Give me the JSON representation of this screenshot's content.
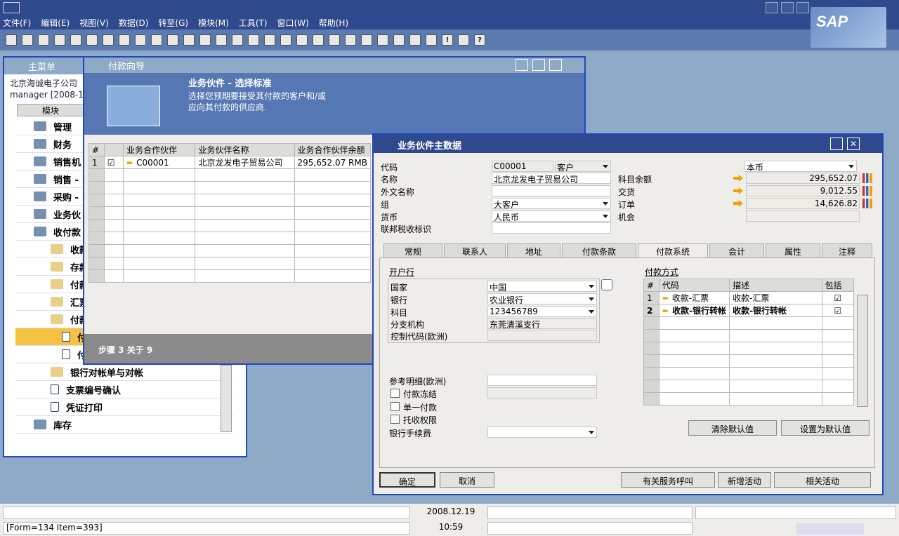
{
  "menu": [
    "文件(F)",
    "编辑(E)",
    "视图(V)",
    "数据(D)",
    "转至(G)",
    "模块(M)",
    "工具(T)",
    "窗口(W)",
    "帮助(H)"
  ],
  "brand": "SAP",
  "main_menu": {
    "title": "主菜单",
    "company": "北京海诚电子公司",
    "user": "manager  [2008-12",
    "module_label": "模块",
    "items": [
      {
        "label": "管理",
        "bold": true
      },
      {
        "label": "财务",
        "bold": true
      },
      {
        "label": "销售机",
        "bold": true
      },
      {
        "label": "销售 -",
        "bold": true
      },
      {
        "label": "采购 -",
        "bold": true
      },
      {
        "label": "业务伙",
        "bold": true
      },
      {
        "label": "收付款",
        "bold": true
      },
      {
        "label": "收款"
      },
      {
        "label": "存款"
      },
      {
        "label": "付款"
      },
      {
        "label": "汇票"
      },
      {
        "label": "付款系"
      },
      {
        "label": "付"
      },
      {
        "label": "付"
      },
      {
        "label": "银行对帐单与对帐"
      },
      {
        "label": "支票编号确认"
      },
      {
        "label": "凭证打印"
      },
      {
        "label": "库存",
        "bold": true
      }
    ]
  },
  "wizard": {
    "title": "付款向导",
    "heading": "业务伙件 - 选择标准",
    "desc1": "选择您预期要接受其付款的客户和/或",
    "desc2": "应向其付款的供应商.",
    "cols": [
      "#",
      "",
      "业务合作伙伴",
      "业务伙伴名称",
      "业务合作伙伴余额"
    ],
    "row": {
      "num": "1",
      "code": "C00001",
      "name": "北京龙发电子贸易公司",
      "balance": "295,652.07 RMB"
    },
    "step": "步骤 3 关于 9"
  },
  "bp": {
    "title": "业务伙件主数据",
    "code_label": "代码",
    "code": "C00001",
    "type": "客户",
    "name_label": "名称",
    "name": "北京龙发电子贸易公司",
    "fname_label": "外文名称",
    "group_label": "组",
    "group": "大客户",
    "currency_label": "货币",
    "currency": "人民币",
    "taxid_label": "联邦税收标识",
    "local_currency": "本币",
    "balance_label": "科目余额",
    "balance": "295,652.07",
    "delivery_label": "交货",
    "delivery": "9,012.55",
    "orders_label": "订单",
    "orders": "14,626.82",
    "opp_label": "机会",
    "tabs": [
      "常规",
      "联系人",
      "地址",
      "付款条款",
      "付款系统",
      "会计",
      "属性",
      "注释"
    ],
    "bank_section": "开户行",
    "country_label": "国家",
    "country": "中国",
    "bank_label": "银行",
    "bank": "农业银行",
    "account_label": "科目",
    "account": "123456789",
    "branch_label": "分支机构",
    "branch": "东莞清溪支行",
    "ctrl_label": "控制代码(欧洲)",
    "ref_label": "参考明细(欧洲)",
    "block_label": "付款冻结",
    "single_label": "单一付款",
    "collect_label": "托收权限",
    "fee_label": "银行手续费",
    "pm_section": "付款方式",
    "pm_cols": [
      "#",
      "代码",
      "描述",
      "包括"
    ],
    "pm_rows": [
      {
        "num": "1",
        "code": "收款-汇票",
        "desc": "收款-汇票"
      },
      {
        "num": "2",
        "code": "收款-银行转帐",
        "desc": "收款-银行转帐"
      }
    ],
    "clear_default": "清除默认值",
    "set_default": "设置为默认值",
    "ok": "确定",
    "cancel": "取消",
    "service_call": "有关服务呼叫",
    "new_activity": "新增活动",
    "related_activity": "相关活动"
  },
  "status": {
    "date": "2008.12.19",
    "time": "10:59",
    "form": "[Form=134 Item=393]"
  }
}
